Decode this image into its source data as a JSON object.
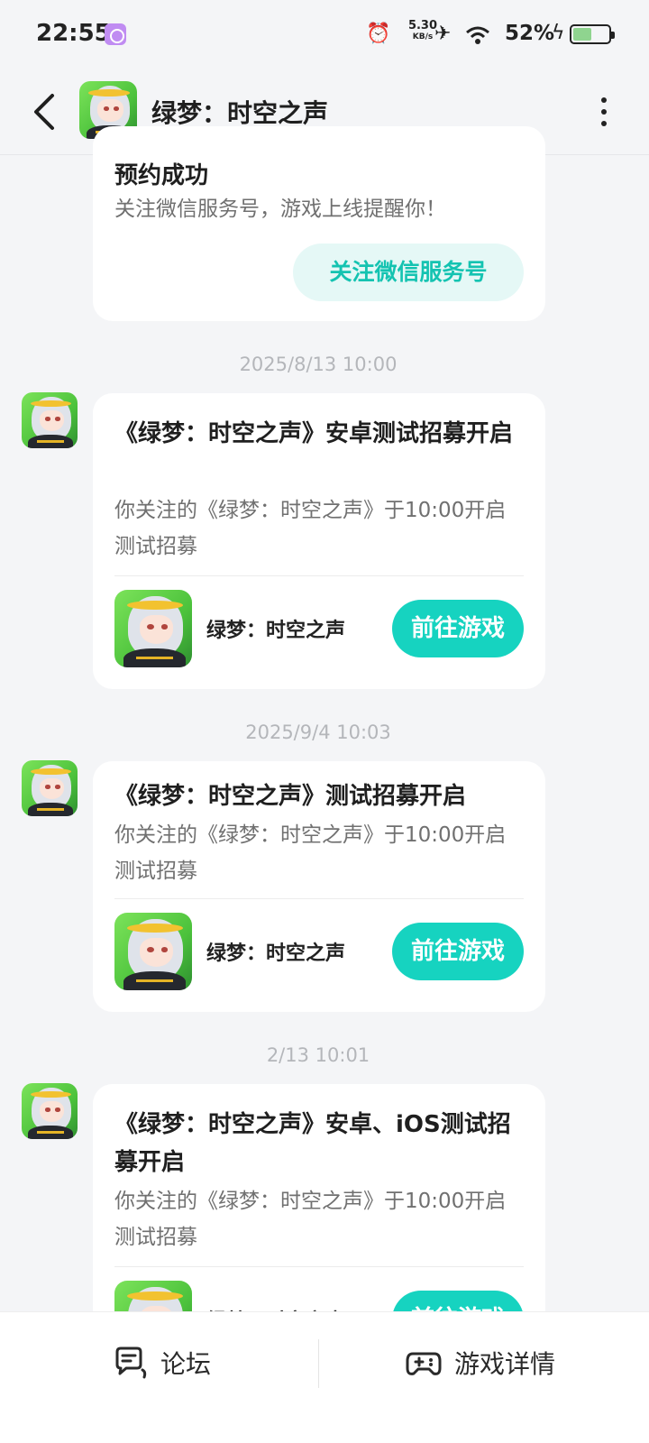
{
  "status_bar": {
    "time": "22:55",
    "net_speed_value": "5.30",
    "net_speed_unit": "KB/s",
    "battery_percent": "52%",
    "battery_level": 0.52
  },
  "header": {
    "title": "绿梦：时空之声"
  },
  "reservation_card": {
    "title": "预约成功",
    "body": "关注微信服务号，游戏上线提醒你！",
    "follow_label": "关注微信服务号"
  },
  "messages": [
    {
      "timestamp": "2025/8/13  10:00",
      "title": "《绿梦：时空之声》安卓测试招募开启",
      "body": "你关注的《绿梦：时空之声》于10:00开启测试招募",
      "game_name": "绿梦：时空之声",
      "button_label": "前往游戏"
    },
    {
      "timestamp": "2025/9/4  10:03",
      "title": "《绿梦：时空之声》测试招募开启",
      "body": "你关注的《绿梦：时空之声》于10:00开启测试招募",
      "game_name": "绿梦：时空之声",
      "button_label": "前往游戏"
    },
    {
      "timestamp": "2/13  10:01",
      "title": "《绿梦：时空之声》安卓、iOS测试招募开启",
      "body": "你关注的《绿梦：时空之声》于10:00开启测试招募",
      "game_name": "绿梦：时空之声",
      "button_label": "前往游戏"
    }
  ],
  "bottom_bar": {
    "forum_label": "论坛",
    "forum_icon": "chat-bubble-icon",
    "details_label": "游戏详情",
    "details_icon": "gamepad-icon"
  },
  "colors": {
    "accent": "#16d3c0",
    "accent_soft": "#e5f8f6",
    "background": "#f4f5f7"
  }
}
